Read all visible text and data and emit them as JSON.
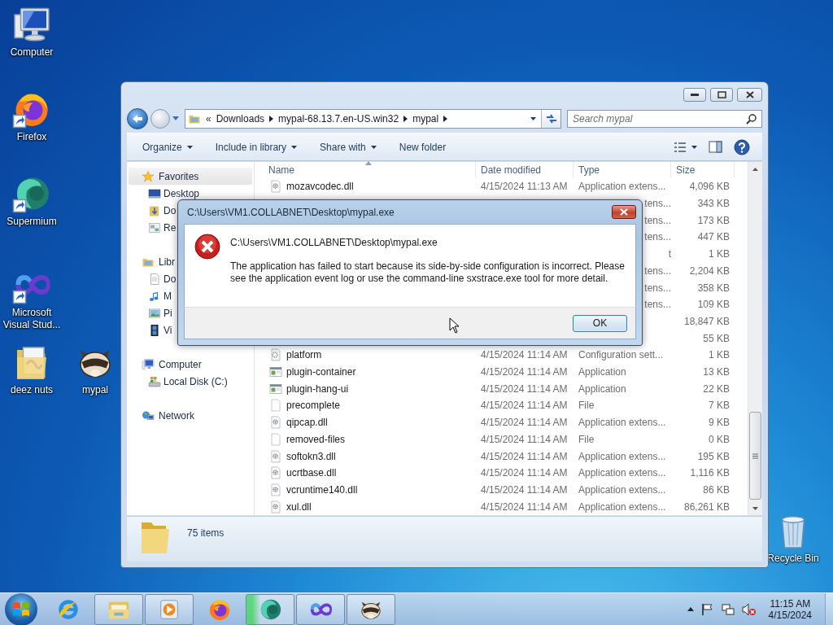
{
  "desktop": {
    "icons": [
      {
        "label": "Computer",
        "kind": "computer",
        "shortcut": false
      },
      {
        "label": "Firefox",
        "kind": "firefox",
        "shortcut": true
      },
      {
        "label": "Supermium",
        "kind": "supermium",
        "shortcut": true
      },
      {
        "label": "Microsoft Visual Stud...",
        "kind": "vs",
        "shortcut": true
      },
      {
        "label": "deez nuts",
        "kind": "folderdoc",
        "shortcut": false
      },
      {
        "label": "mypal",
        "kind": "raccoon",
        "shortcut": false
      },
      {
        "label": "Recycle Bin",
        "kind": "bin",
        "shortcut": false
      }
    ]
  },
  "explorer": {
    "address": {
      "overflow": "«",
      "crumbs": [
        "Downloads",
        "mypal-68.13.7.en-US.win32",
        "mypal"
      ]
    },
    "search": {
      "placeholder": "Search mypal"
    },
    "toolbar": [
      {
        "label": "Organize",
        "dropdown": true
      },
      {
        "label": "Include in library",
        "dropdown": true
      },
      {
        "label": "Share with",
        "dropdown": true
      },
      {
        "label": "New folder",
        "dropdown": false
      }
    ],
    "nav": [
      {
        "label": "Favorites",
        "kind": "star",
        "selected": true,
        "children": [
          {
            "label": "Desktop",
            "kind": "desk",
            "selected": false
          },
          {
            "label": "Do",
            "kind": "downloads",
            "selected": false
          },
          {
            "label": "Re",
            "kind": "recent",
            "selected": false
          }
        ]
      },
      {
        "label": "Libr",
        "kind": "library",
        "selected": false,
        "children": [
          {
            "label": "Do",
            "kind": "documents",
            "selected": false
          },
          {
            "label": "M",
            "kind": "music",
            "selected": false
          },
          {
            "label": "Pi",
            "kind": "pictures",
            "selected": false
          },
          {
            "label": "Vi",
            "kind": "videos",
            "selected": false
          }
        ]
      },
      {
        "label": "Computer",
        "kind": "pc",
        "selected": false,
        "children": [
          {
            "label": "Local Disk (C:)",
            "kind": "disk",
            "selected": false
          }
        ]
      },
      {
        "label": "Network",
        "kind": "network",
        "selected": false
      }
    ],
    "columns": [
      "Name",
      "Date modified",
      "Type",
      "Size"
    ],
    "rows": [
      {
        "kind": "dll",
        "name": "mozavcodec.dll",
        "date": "4/15/2024 11:13 AM",
        "type": "Application extens...",
        "size": "4,096 KB"
      },
      {
        "type": "tens...",
        "size": "343 KB"
      },
      {
        "type": "tens...",
        "size": "173 KB"
      },
      {
        "type": "tens...",
        "size": "447 KB"
      },
      {
        "type": "t",
        "size": "1 KB"
      },
      {
        "type": "tens...",
        "size": "2,204 KB"
      },
      {
        "type": "tens...",
        "size": "358 KB"
      },
      {
        "type": "tens...",
        "size": "109 KB"
      },
      {
        "size": "18,847 KB"
      },
      {
        "size": "55 KB"
      },
      {
        "kind": "config",
        "name": "platform",
        "date": "4/15/2024 11:14 AM",
        "type": "Configuration sett...",
        "size": "1 KB"
      },
      {
        "kind": "app",
        "name": "plugin-container",
        "date": "4/15/2024 11:14 AM",
        "type": "Application",
        "size": "13 KB"
      },
      {
        "kind": "app",
        "name": "plugin-hang-ui",
        "date": "4/15/2024 11:14 AM",
        "type": "Application",
        "size": "22 KB"
      },
      {
        "kind": "file",
        "name": "precomplete",
        "date": "4/15/2024 11:14 AM",
        "type": "File",
        "size": "7 KB"
      },
      {
        "kind": "dll",
        "name": "qipcap.dll",
        "date": "4/15/2024 11:14 AM",
        "type": "Application extens...",
        "size": "9 KB"
      },
      {
        "kind": "file",
        "name": "removed-files",
        "date": "4/15/2024 11:14 AM",
        "type": "File",
        "size": "0 KB"
      },
      {
        "kind": "dll",
        "name": "softokn3.dll",
        "date": "4/15/2024 11:14 AM",
        "type": "Application extens...",
        "size": "195 KB"
      },
      {
        "kind": "dll",
        "name": "ucrtbase.dll",
        "date": "4/15/2024 11:14 AM",
        "type": "Application extens...",
        "size": "1,116 KB"
      },
      {
        "kind": "dll",
        "name": "vcruntime140.dll",
        "date": "4/15/2024 11:14 AM",
        "type": "Application extens...",
        "size": "86 KB"
      },
      {
        "kind": "dll",
        "name": "xul.dll",
        "date": "4/15/2024 11:14 AM",
        "type": "Application extens...",
        "size": "86,261 KB"
      }
    ],
    "status": "75 items"
  },
  "dialog": {
    "title": "C:\\Users\\VM1.COLLABNET\\Desktop\\mypal.exe",
    "heading": "C:\\Users\\VM1.COLLABNET\\Desktop\\mypal.exe",
    "message": "The application has failed to start because its side-by-side configuration is incorrect. Please see the application event log or use the command-line sxstrace.exe tool for more detail.",
    "button": "OK"
  },
  "taskbar": {
    "items": [
      {
        "kind": "ie",
        "running": false,
        "active": false
      },
      {
        "kind": "explorer",
        "running": true,
        "active": false
      },
      {
        "kind": "media",
        "running": true,
        "active": false
      },
      {
        "kind": "firefox",
        "running": false,
        "active": false
      },
      {
        "kind": "supermium",
        "running": true,
        "active": true
      },
      {
        "kind": "vs",
        "running": true,
        "active": false
      },
      {
        "kind": "raccoon",
        "running": true,
        "active": false
      }
    ],
    "time": "11:15 AM",
    "date": "4/15/2024"
  }
}
